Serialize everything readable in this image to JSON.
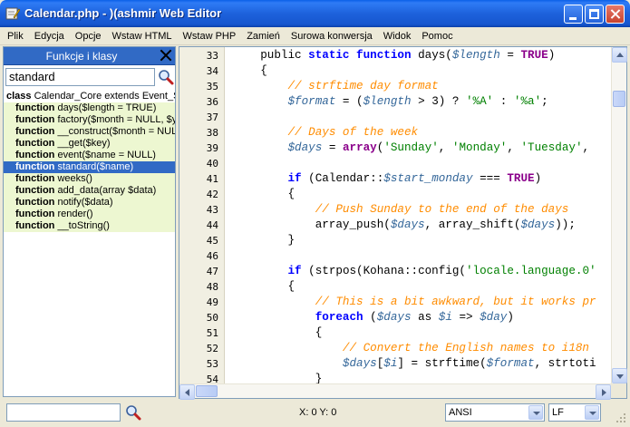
{
  "window": {
    "title": "Calendar.php - )(ashmir Web Editor",
    "app_icon": "pencil-icon"
  },
  "menu": [
    "Plik",
    "Edycja",
    "Opcje",
    "Wstaw HTML",
    "Wstaw PHP",
    "Zamień",
    "Surowa konwersja",
    "Widok",
    "Pomoc"
  ],
  "sidebar": {
    "title": "Funkcje i klasy",
    "search_value": "standard",
    "items": [
      {
        "kw": "class",
        "text": " Calendar_Core extends Event_Subject",
        "type": "class"
      },
      {
        "kw": "function",
        "text": " days($length = TRUE)",
        "type": "method"
      },
      {
        "kw": "function",
        "text": " factory($month = NULL, $year = NULL)",
        "type": "method"
      },
      {
        "kw": "function",
        "text": " __construct($month = NULL, $year = NULL)",
        "type": "method"
      },
      {
        "kw": "function",
        "text": " __get($key)",
        "type": "method"
      },
      {
        "kw": "function",
        "text": " event($name = NULL)",
        "type": "method"
      },
      {
        "kw": "function",
        "text": " standard($name)",
        "type": "selected"
      },
      {
        "kw": "function",
        "text": " weeks()",
        "type": "method"
      },
      {
        "kw": "function",
        "text": " add_data(array $data)",
        "type": "method"
      },
      {
        "kw": "function",
        "text": " notify($data)",
        "type": "method"
      },
      {
        "kw": "function",
        "text": " render()",
        "type": "method"
      },
      {
        "kw": "function",
        "text": " __toString()",
        "type": "method"
      }
    ]
  },
  "editor": {
    "lines": [
      {
        "n": "33",
        "tokens": [
          [
            "plain",
            "    public "
          ],
          [
            "kw",
            "static function"
          ],
          [
            "plain",
            " days("
          ],
          [
            "var",
            "$length"
          ],
          [
            "plain",
            " = "
          ],
          [
            "const",
            "TRUE"
          ],
          [
            "plain",
            ")"
          ]
        ]
      },
      {
        "n": "34",
        "tokens": [
          [
            "plain",
            "    {"
          ]
        ]
      },
      {
        "n": "35",
        "tokens": [
          [
            "plain",
            "        "
          ],
          [
            "cmt",
            "// strftime day format"
          ]
        ]
      },
      {
        "n": "36",
        "tokens": [
          [
            "plain",
            "        "
          ],
          [
            "var",
            "$format"
          ],
          [
            "plain",
            " = ("
          ],
          [
            "var",
            "$length"
          ],
          [
            "plain",
            " > 3) ? "
          ],
          [
            "str",
            "'%A'"
          ],
          [
            "plain",
            " : "
          ],
          [
            "str",
            "'%a'"
          ],
          [
            "plain",
            ";"
          ]
        ]
      },
      {
        "n": "37",
        "tokens": [
          [
            "plain",
            ""
          ]
        ]
      },
      {
        "n": "38",
        "tokens": [
          [
            "plain",
            "        "
          ],
          [
            "cmt",
            "// Days of the week"
          ]
        ]
      },
      {
        "n": "39",
        "tokens": [
          [
            "plain",
            "        "
          ],
          [
            "var",
            "$days"
          ],
          [
            "plain",
            " = "
          ],
          [
            "kw2",
            "array"
          ],
          [
            "plain",
            "("
          ],
          [
            "str",
            "'Sunday'"
          ],
          [
            "plain",
            ", "
          ],
          [
            "str",
            "'Monday'"
          ],
          [
            "plain",
            ", "
          ],
          [
            "str",
            "'Tuesday'"
          ],
          [
            "plain",
            ","
          ]
        ]
      },
      {
        "n": "40",
        "tokens": [
          [
            "plain",
            ""
          ]
        ]
      },
      {
        "n": "41",
        "tokens": [
          [
            "plain",
            "        "
          ],
          [
            "kw",
            "if"
          ],
          [
            "plain",
            " (Calendar::"
          ],
          [
            "var",
            "$start_monday"
          ],
          [
            "plain",
            " === "
          ],
          [
            "const",
            "TRUE"
          ],
          [
            "plain",
            ")"
          ]
        ]
      },
      {
        "n": "42",
        "tokens": [
          [
            "plain",
            "        {"
          ]
        ]
      },
      {
        "n": "43",
        "tokens": [
          [
            "plain",
            "            "
          ],
          [
            "cmt",
            "// Push Sunday to the end of the days"
          ]
        ]
      },
      {
        "n": "44",
        "tokens": [
          [
            "plain",
            "            array_push("
          ],
          [
            "var",
            "$days"
          ],
          [
            "plain",
            ", array_shift("
          ],
          [
            "var",
            "$days"
          ],
          [
            "plain",
            "));"
          ]
        ]
      },
      {
        "n": "45",
        "tokens": [
          [
            "plain",
            "        }"
          ]
        ]
      },
      {
        "n": "46",
        "tokens": [
          [
            "plain",
            ""
          ]
        ]
      },
      {
        "n": "47",
        "tokens": [
          [
            "plain",
            "        "
          ],
          [
            "kw",
            "if"
          ],
          [
            "plain",
            " (strpos(Kohana::config("
          ],
          [
            "str",
            "'locale.language.0'"
          ]
        ]
      },
      {
        "n": "48",
        "tokens": [
          [
            "plain",
            "        {"
          ]
        ]
      },
      {
        "n": "49",
        "tokens": [
          [
            "plain",
            "            "
          ],
          [
            "cmt",
            "// This is a bit awkward, but it works pr"
          ]
        ]
      },
      {
        "n": "50",
        "tokens": [
          [
            "plain",
            "            "
          ],
          [
            "kw",
            "foreach"
          ],
          [
            "plain",
            " ("
          ],
          [
            "var",
            "$days"
          ],
          [
            "plain",
            " as "
          ],
          [
            "var",
            "$i"
          ],
          [
            "plain",
            " => "
          ],
          [
            "var",
            "$day"
          ],
          [
            "plain",
            ")"
          ]
        ]
      },
      {
        "n": "51",
        "tokens": [
          [
            "plain",
            "            {"
          ]
        ]
      },
      {
        "n": "52",
        "tokens": [
          [
            "plain",
            "                "
          ],
          [
            "cmt",
            "// Convert the English names to i18n"
          ]
        ]
      },
      {
        "n": "53",
        "tokens": [
          [
            "plain",
            "                "
          ],
          [
            "var",
            "$days"
          ],
          [
            "plain",
            "["
          ],
          [
            "var",
            "$i"
          ],
          [
            "plain",
            "] = strftime("
          ],
          [
            "var",
            "$format"
          ],
          [
            "plain",
            ", strtoti"
          ]
        ]
      },
      {
        "n": "54",
        "tokens": [
          [
            "plain",
            "            }"
          ]
        ]
      }
    ]
  },
  "status": {
    "search_value": "",
    "position": "X: 0 Y: 0",
    "encoding": "ANSI",
    "line_ending": "LF"
  }
}
